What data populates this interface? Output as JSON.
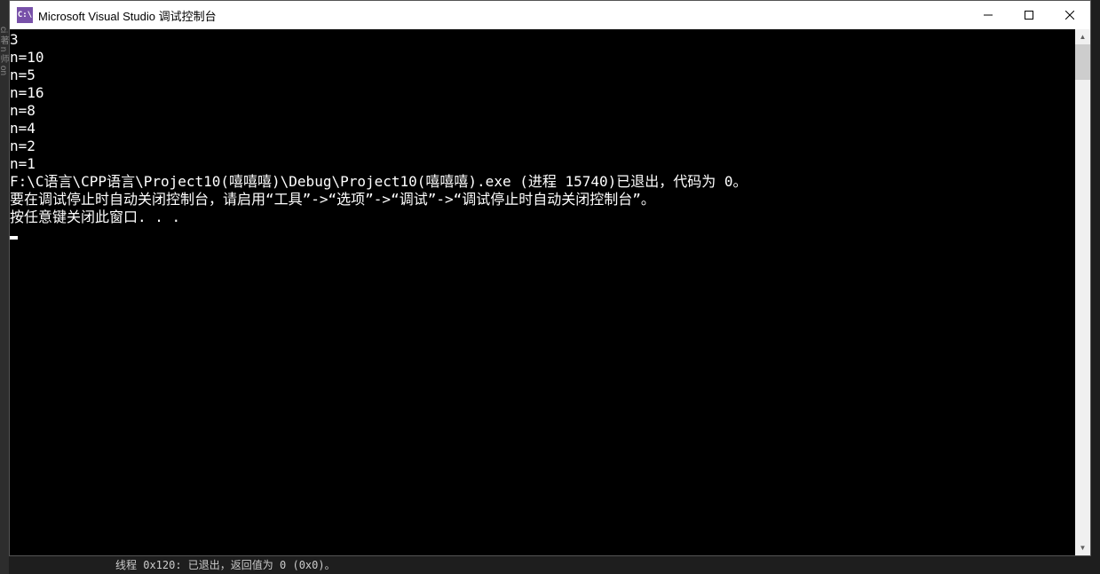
{
  "titlebar": {
    "icon_text": "C:\\",
    "title": "Microsoft Visual Studio 调试控制台"
  },
  "console": {
    "lines": [
      "3",
      "n=10",
      "n=5",
      "n=16",
      "n=8",
      "n=4",
      "n=2",
      "n=1",
      "",
      "F:\\C语言\\CPP语言\\Project10(嘻嘻嘻)\\Debug\\Project10(嘻嘻嘻).exe (进程 15740)已退出，代码为 0。",
      "要在调试停止时自动关闭控制台，请启用“工具”->“选项”->“调试”->“调试停止时自动关闭控制台”。",
      "按任意键关闭此窗口. . ."
    ]
  },
  "bottom_strip": {
    "text": "线程 0x120: 已退出，返回值为 0 (0x0)。"
  },
  "left_gutter": {
    "chars": "ci 著 n 师 on"
  }
}
